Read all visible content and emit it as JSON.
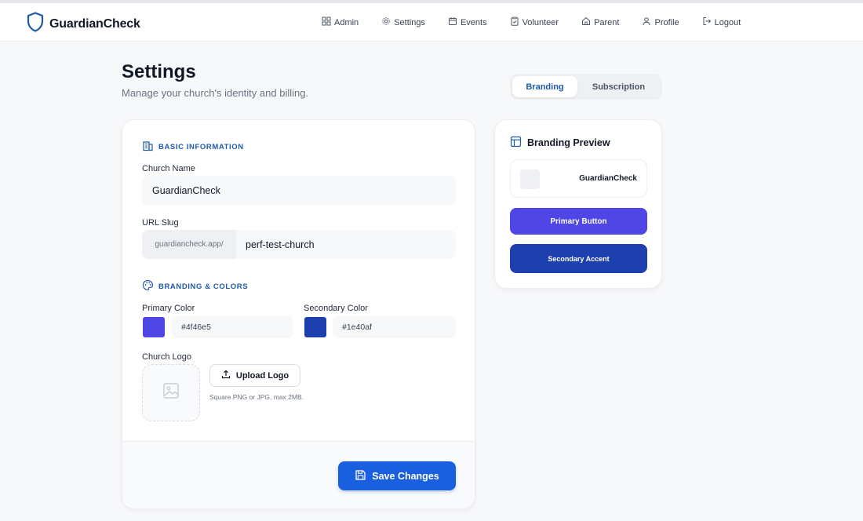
{
  "app": {
    "name": "GuardianCheck"
  },
  "nav": {
    "items": [
      {
        "label": "Admin",
        "icon": "grid-icon"
      },
      {
        "label": "Settings",
        "icon": "gear-icon"
      },
      {
        "label": "Events",
        "icon": "calendar-icon"
      },
      {
        "label": "Volunteer",
        "icon": "clipboard-check-icon"
      },
      {
        "label": "Parent",
        "icon": "home-icon"
      },
      {
        "label": "Profile",
        "icon": "user-icon"
      },
      {
        "label": "Logout",
        "icon": "logout-icon"
      }
    ]
  },
  "page": {
    "title": "Settings",
    "subtitle": "Manage your church's identity and billing."
  },
  "tabs": [
    {
      "label": "Branding",
      "active": true
    },
    {
      "label": "Subscription",
      "active": false
    }
  ],
  "basic_info": {
    "heading": "BASIC INFORMATION",
    "church_name_label": "Church Name",
    "church_name_value": "GuardianCheck",
    "url_slug_label": "URL Slug",
    "url_prefix": "guardiancheck.app/",
    "url_slug_value": "perf-test-church"
  },
  "branding": {
    "heading": "BRANDING & COLORS",
    "primary_label": "Primary Color",
    "primary_value": "#4f46e5",
    "secondary_label": "Secondary Color",
    "secondary_value": "#1e40af",
    "logo_label": "Church Logo",
    "upload_label": "Upload Logo",
    "hint": "Square PNG or JPG, max 2MB."
  },
  "actions": {
    "save_label": "Save Changes"
  },
  "preview": {
    "title": "Branding Preview",
    "brand_name": "GuardianCheck",
    "primary_button": "Primary Button",
    "secondary_accent": "Secondary Accent"
  },
  "colors": {
    "accent": "#1a5fe0",
    "heading_blue": "#1e5aa8",
    "primary": "#4f46e5",
    "secondary": "#1e40af"
  }
}
